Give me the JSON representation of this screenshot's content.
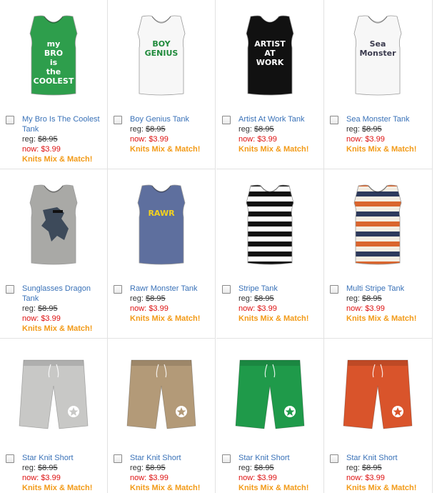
{
  "products": [
    {
      "name": "My Bro Is The Coolest Tank",
      "reg_label": "reg:",
      "reg_price": "$8.95",
      "now_label": "now:",
      "now_price": "$3.99",
      "promo": "Knits Mix & Match!",
      "kind": "tank",
      "color": "#2e9e4c",
      "graphic_text": "my BRO is the COOLEST",
      "graphic_color": "#ffffff"
    },
    {
      "name": "Boy Genius Tank",
      "reg_label": "reg:",
      "reg_price": "$8.95",
      "now_label": "now:",
      "now_price": "$3.99",
      "promo": "Knits Mix & Match!",
      "kind": "tank",
      "color": "#f7f7f7",
      "graphic_text": "BOY GENIUS",
      "graphic_color": "#1f8a3b"
    },
    {
      "name": "Artist At Work Tank",
      "reg_label": "reg:",
      "reg_price": "$8.95",
      "now_label": "now:",
      "now_price": "$3.99",
      "promo": "Knits Mix & Match!",
      "kind": "tank",
      "color": "#111111",
      "graphic_text": "ARTIST AT WORK",
      "graphic_color": "#ffffff"
    },
    {
      "name": "Sea Monster Tank",
      "reg_label": "reg:",
      "reg_price": "$8.95",
      "now_label": "now:",
      "now_price": "$3.99",
      "promo": "Knits Mix & Match!",
      "kind": "tank",
      "color": "#f7f7f7",
      "graphic_text": "Sea Monster",
      "graphic_color": "#3b3b4e"
    },
    {
      "name": "Sunglasses Dragon Tank",
      "reg_label": "reg:",
      "reg_price": "$8.95",
      "now_label": "now:",
      "now_price": "$3.99",
      "promo": "Knits Mix & Match!",
      "kind": "tank",
      "color": "#a9a9a6",
      "graphic_text": "",
      "graphic_color": "#3d4a5a"
    },
    {
      "name": "Rawr Monster Tank",
      "reg_label": "reg:",
      "reg_price": "$8.95",
      "now_label": "now:",
      "now_price": "$3.99",
      "promo": "Knits Mix & Match!",
      "kind": "tank",
      "color": "#5e6f9e",
      "graphic_text": "RAWR",
      "graphic_color": "#f4d21f"
    },
    {
      "name": "Stripe Tank",
      "reg_label": "reg:",
      "reg_price": "$8.95",
      "now_label": "now:",
      "now_price": "$3.99",
      "promo": "Knits Mix & Match!",
      "kind": "stripe",
      "color": "#111111",
      "stripe_colors": [
        "#111111",
        "#ffffff"
      ]
    },
    {
      "name": "Multi Stripe Tank",
      "reg_label": "reg:",
      "reg_price": "$8.95",
      "now_label": "now:",
      "now_price": "$3.99",
      "promo": "Knits Mix & Match!",
      "kind": "stripe",
      "color": "#d9652e",
      "stripe_colors": [
        "#d9652e",
        "#f4ede2",
        "#2d3a5c",
        "#f4ede2"
      ]
    },
    {
      "name": "Star Knit Short",
      "reg_label": "reg:",
      "reg_price": "$8.95",
      "now_label": "now:",
      "now_price": "$3.99",
      "promo": "Knits Mix & Match!",
      "kind": "short",
      "color": "#c8c8c6"
    },
    {
      "name": "Star Knit Short",
      "reg_label": "reg:",
      "reg_price": "$8.95",
      "now_label": "now:",
      "now_price": "$3.99",
      "promo": "Knits Mix & Match!",
      "kind": "short",
      "color": "#b39a78"
    },
    {
      "name": "Star Knit Short",
      "reg_label": "reg:",
      "reg_price": "$8.95",
      "now_label": "now:",
      "now_price": "$3.99",
      "promo": "Knits Mix & Match!",
      "kind": "short",
      "color": "#1f9a4a"
    },
    {
      "name": "Star Knit Short",
      "reg_label": "reg:",
      "reg_price": "$8.95",
      "now_label": "now:",
      "now_price": "$3.99",
      "promo": "Knits Mix & Match!",
      "kind": "short",
      "color": "#d9542b"
    }
  ]
}
